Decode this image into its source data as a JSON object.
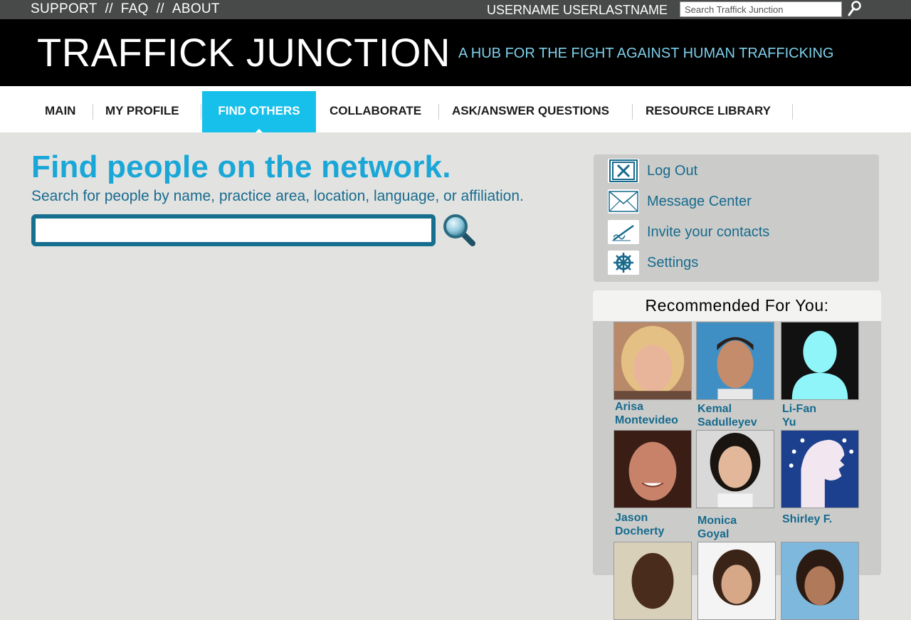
{
  "topbar": {
    "links": [
      "SUPPORT",
      "FAQ",
      "ABOUT"
    ],
    "separator": "//",
    "username": "USERNAME USERLASTNAME",
    "search_placeholder": "Search Traffick Junction"
  },
  "header": {
    "title": "TRAFFICK JUNCTION",
    "tagline": "A HUB FOR THE FIGHT AGAINST HUMAN TRAFFICKING"
  },
  "nav": {
    "items": [
      "MAIN",
      "MY PROFILE",
      "FIND OTHERS",
      "COLLABORATE",
      "ASK/ANSWER QUESTIONS",
      "RESOURCE LIBRARY"
    ],
    "active": "FIND OTHERS"
  },
  "main": {
    "title": "Find people on the network.",
    "subtitle": "Search for people by name, practice area, location, language, or affiliation.",
    "search_value": ""
  },
  "side_menu": {
    "items": [
      "Log Out",
      "Message Center",
      "Invite your contacts",
      "Settings"
    ]
  },
  "recommended": {
    "heading": "Recommended For You:",
    "people": [
      {
        "first": "Arisa",
        "last": "Montevideo"
      },
      {
        "first": "Kemal",
        "last": "Sadulleyev"
      },
      {
        "first": "Li-Fan",
        "last": "Yu"
      },
      {
        "first": "Jason",
        "last": "Docherty"
      },
      {
        "first": "Monica",
        "last": "Goyal"
      },
      {
        "first": "Shirley F.",
        "last": ""
      }
    ]
  },
  "colors": {
    "accent": "#16c0ea",
    "title_blue": "#1aa7d8",
    "link_blue": "#176a8d",
    "header_bg": "#000000",
    "topbar_bg": "#474a48"
  }
}
